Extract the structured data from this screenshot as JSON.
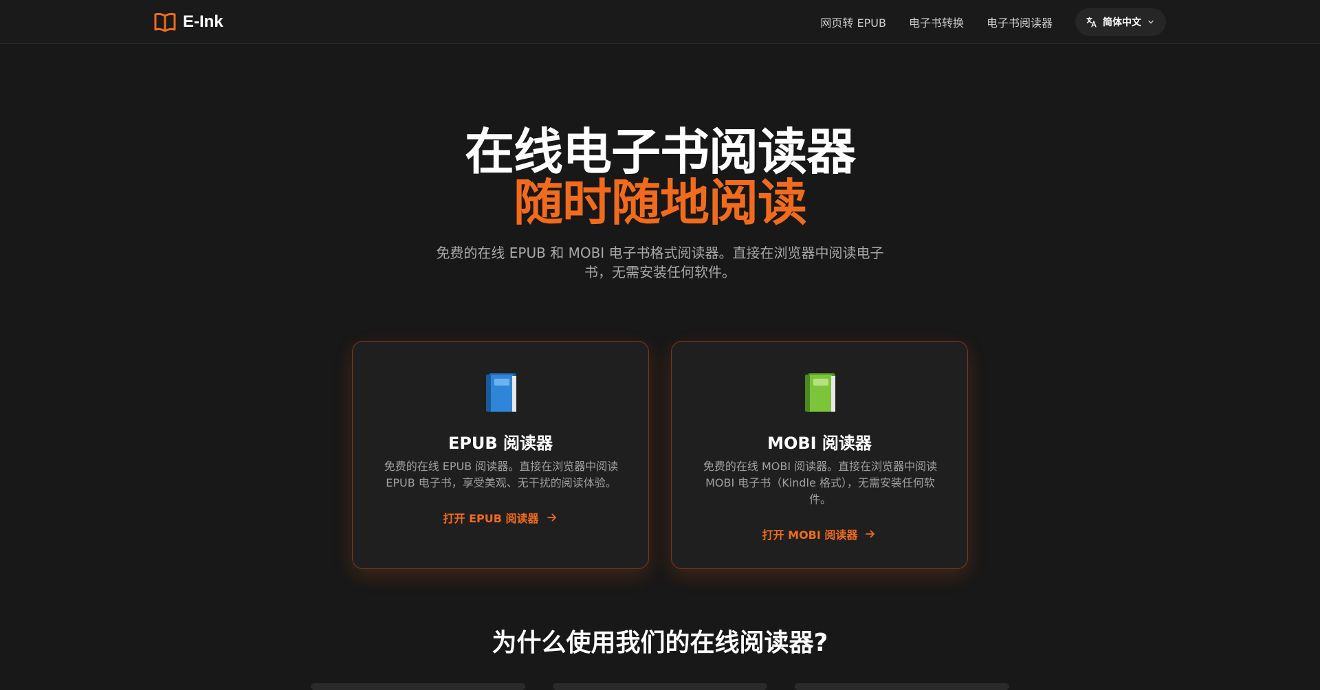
{
  "header": {
    "brand": "E-Ink",
    "nav": [
      "网页转 EPUB",
      "电子书转换",
      "电子书阅读器"
    ],
    "language": "简体中文"
  },
  "hero": {
    "title": "在线电子书阅读器",
    "accent": "随时随地阅读",
    "subtitle": "免费的在线 EPUB 和 MOBI 电子书格式阅读器。直接在浏览器中阅读电子书，无需安装任何软件。"
  },
  "cards": [
    {
      "title": "EPUB 阅读器",
      "description": "免费的在线 EPUB 阅读器。直接在浏览器中阅读 EPUB 电子书，享受美观、无干扰的阅读体验。",
      "link": "打开 EPUB 阅读器",
      "icon": "blue-book-icon",
      "icon_color": "#2f86d8"
    },
    {
      "title": "MOBI 阅读器",
      "description": "免费的在线 MOBI 阅读器。直接在浏览器中阅读 MOBI 电子书（Kindle 格式），无需安装任何软件。",
      "link": "打开 MOBI 阅读器",
      "icon": "green-book-icon",
      "icon_color": "#7cc43a"
    }
  ],
  "why_title": "为什么使用我们的在线阅读器?",
  "colors": {
    "accent": "#f26b1d",
    "background": "#181818",
    "card": "#1f1f1f"
  }
}
